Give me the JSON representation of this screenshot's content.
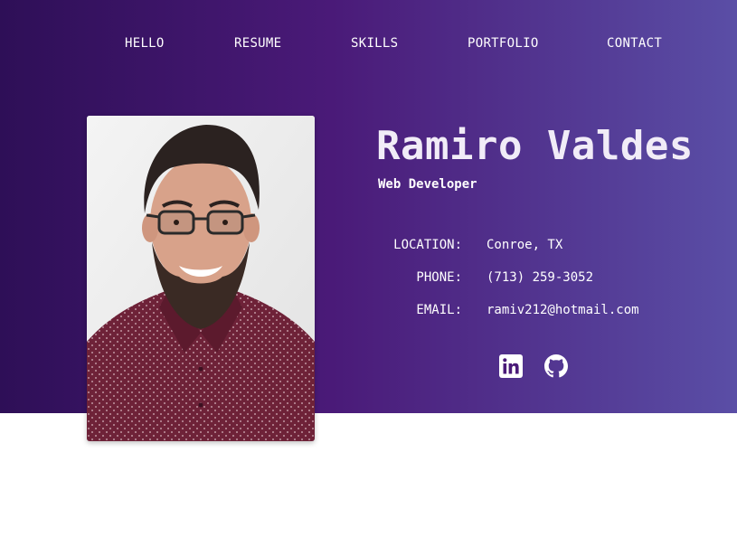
{
  "nav": {
    "items": [
      "HELLO",
      "RESUME",
      "SKILLS",
      "PORTFOLIO",
      "CONTACT"
    ]
  },
  "profile": {
    "name": "Ramiro Valdes",
    "title": "Web Developer",
    "photo_alt": "Portrait of Ramiro Valdes",
    "location_label": "LOCATION:",
    "location_value": "Conroe, TX",
    "phone_label": "PHONE:",
    "phone_value": "(713) 259-3052",
    "email_label": "EMAIL:",
    "email_value": "ramiv212@hotmail.com"
  },
  "social": {
    "icons": [
      "linkedin-icon",
      "github-icon"
    ]
  },
  "colors": {
    "gradient_start": "#2e0f57",
    "gradient_mid": "#4a1a78",
    "gradient_end": "#5a4ea6",
    "text": "#ffffff",
    "name_text": "#f1ecf7",
    "page_background": "#ffffff"
  }
}
